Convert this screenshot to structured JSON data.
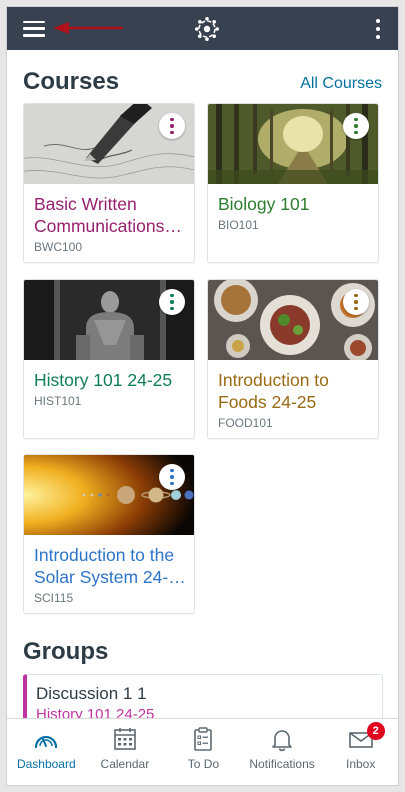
{
  "header": {
    "menu_icon": "hamburger-icon",
    "logo_icon": "canvas-logo-icon",
    "more_icon": "kebab-icon"
  },
  "courses_section": {
    "title": "Courses",
    "all_courses_label": "All Courses",
    "cards": [
      {
        "name": "Basic Written Communications…",
        "code": "BWC100",
        "color": "#97206d",
        "image": "fountain-pen-writing"
      },
      {
        "name": "Biology 101",
        "code": "BIO101",
        "color": "#2d7d2e",
        "image": "forest-path"
      },
      {
        "name": "History 101 24-25",
        "code": "HIST101",
        "color": "#0f7d55",
        "image": "lincoln-memorial-statue"
      },
      {
        "name": "Introduction to Foods 24-25",
        "code": "FOOD101",
        "color": "#9a6a13",
        "image": "plates-of-food"
      },
      {
        "name": "Introduction to the Solar System  24-…",
        "code": "SCI115",
        "color": "#2c74c9",
        "image": "planets-near-sun"
      }
    ]
  },
  "groups_section": {
    "title": "Groups",
    "cards": [
      {
        "name": "Discussion 1 1",
        "course": "History 101 24-25",
        "color": "#bf32a4"
      }
    ]
  },
  "tab_bar": {
    "tabs": [
      {
        "label": "Dashboard",
        "icon": "dashboard-icon",
        "active": true
      },
      {
        "label": "Calendar",
        "icon": "calendar-icon",
        "active": false
      },
      {
        "label": "To Do",
        "icon": "todo-clipboard-icon",
        "active": false
      },
      {
        "label": "Notifications",
        "icon": "bell-icon",
        "active": false
      },
      {
        "label": "Inbox",
        "icon": "envelope-icon",
        "active": false,
        "badge": "2"
      }
    ]
  }
}
